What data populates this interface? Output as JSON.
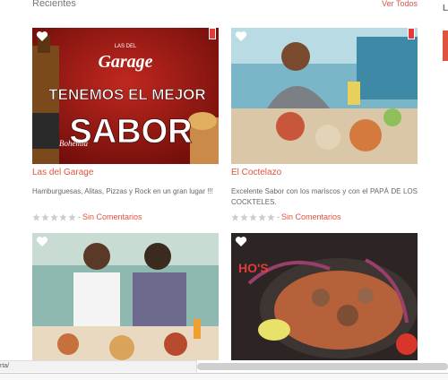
{
  "section": {
    "title": "Recientes",
    "see_all": "Ver Todos"
  },
  "cards": [
    {
      "title": "Las del Garage",
      "description": "Hamburguesas, Alitas, Pizzas y Rock en un gran lugar !!!",
      "rating": 0,
      "comments": "Sin Comentarios",
      "separator": "-",
      "image_text": {
        "logo": "Garage",
        "logo_small": "LAS DEL",
        "line1": "TENEMOS EL MEJOR",
        "line2": "SABOR",
        "bottle": "Bohemia"
      }
    },
    {
      "title": "El Coctelazo",
      "description": "Excelente Sabor con los mariscos y con el PAPÁ DE LOS COCKTELES.",
      "rating": 0,
      "comments": "Sin Comentarios",
      "separator": "-"
    },
    {
      "title": "",
      "description": ""
    },
    {
      "title": "",
      "description": "",
      "image_text": {
        "logo": "HO'S"
      }
    }
  ],
  "right_column": {
    "letter": "L"
  },
  "status_bar": {
    "url": "rta/"
  },
  "colors": {
    "accent": "#e0533c",
    "text": "#666666",
    "star_empty": "#cccccc"
  }
}
